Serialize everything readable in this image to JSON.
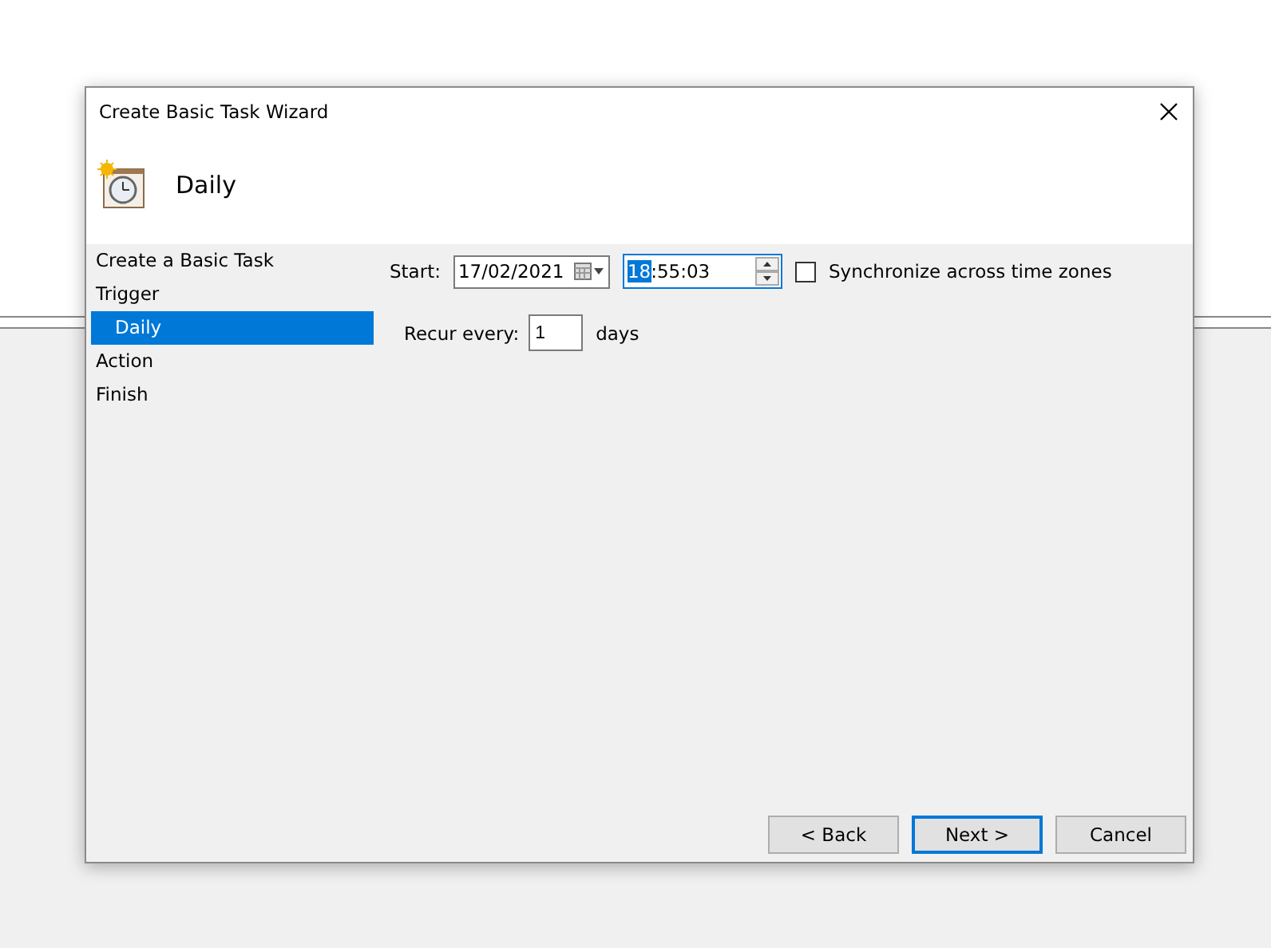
{
  "window": {
    "title": "Create Basic Task Wizard"
  },
  "header": {
    "title": "Daily"
  },
  "sidebar": {
    "items": [
      {
        "label": "Create a Basic Task",
        "selected": false
      },
      {
        "label": "Trigger",
        "selected": false,
        "children": [
          {
            "label": "Daily",
            "selected": true
          }
        ]
      },
      {
        "label": "Action",
        "selected": false
      },
      {
        "label": "Finish",
        "selected": false
      }
    ]
  },
  "start": {
    "label": "Start:",
    "date": "17/02/2021",
    "time_hour": "18",
    "time_hour_selected": true,
    "time_rest": ":55:03"
  },
  "synchronize": {
    "label": "Synchronize across time zones",
    "checked": false
  },
  "recur": {
    "label": "Recur every:",
    "value": "1",
    "unit": "days"
  },
  "buttons": [
    {
      "label": "< Back",
      "default": false
    },
    {
      "label": "Next >",
      "default": true
    },
    {
      "label": "Cancel",
      "default": false
    }
  ]
}
